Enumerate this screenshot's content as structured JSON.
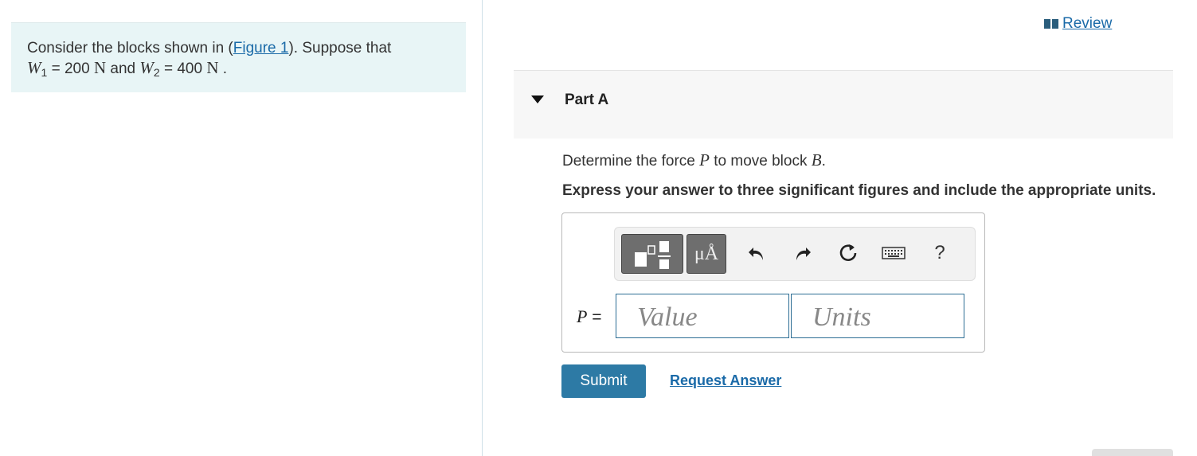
{
  "intro": {
    "text_before_link": "Consider the blocks shown in (",
    "figure_link": "Figure 1",
    "text_after_link": "). Suppose that",
    "w1_symbol": "W",
    "w1_sub": "1",
    "w1_eq": " = 200 ",
    "w1_unit": "N",
    "and": " and ",
    "w2_symbol": "W",
    "w2_sub": "2",
    "w2_eq": " = 400 ",
    "w2_unit": "N",
    "end": " ."
  },
  "review": {
    "label": " Review",
    "icon": "book-icon"
  },
  "part": {
    "title": "Part A",
    "question_before": "Determine the force ",
    "question_var": "P",
    "question_middle": " to move block ",
    "question_block": "B",
    "question_after": ".",
    "instructions": "Express your answer to three significant figures and include the appropriate units."
  },
  "toolbar": {
    "units_button": "μÅ",
    "help": "?",
    "icons": [
      "templates-icon",
      "units-icon",
      "undo-icon",
      "redo-icon",
      "reset-icon",
      "keyboard-icon",
      "help-icon"
    ]
  },
  "answer": {
    "var": "P",
    "equals": " =",
    "value_placeholder": "Value",
    "units_placeholder": "Units"
  },
  "actions": {
    "submit": "Submit",
    "request_answer": "Request Answer"
  },
  "colors": {
    "accent": "#2d7aa5",
    "link": "#1a6aa8",
    "intro_bg": "#e8f5f6"
  }
}
